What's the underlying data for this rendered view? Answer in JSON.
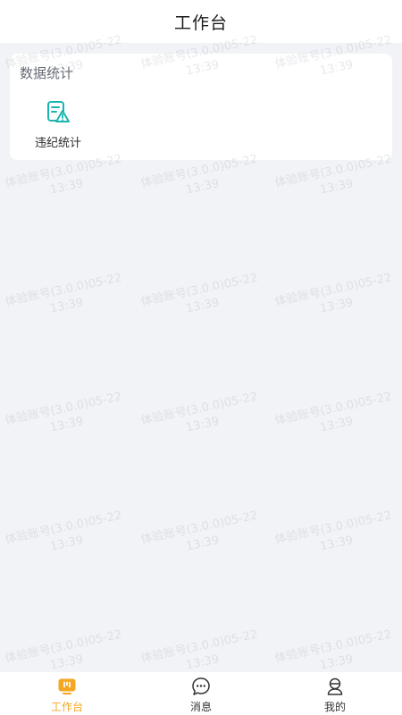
{
  "header": {
    "title": "工作台"
  },
  "card": {
    "title": "数据统计",
    "tiles": [
      {
        "label": "违纪统计",
        "icon": "violation-report-icon"
      }
    ]
  },
  "watermark": {
    "line1": "体验账号(3.0.0)05-22",
    "line2": "13:39"
  },
  "tabbar": {
    "items": [
      {
        "label": "工作台",
        "icon": "workbench-icon",
        "active": true
      },
      {
        "label": "消息",
        "icon": "message-icon",
        "active": false
      },
      {
        "label": "我的",
        "icon": "profile-icon",
        "active": false
      }
    ]
  },
  "colors": {
    "accent": "#f5a623",
    "icon_teal": "#1ab5b0",
    "background": "#f2f3f7"
  }
}
